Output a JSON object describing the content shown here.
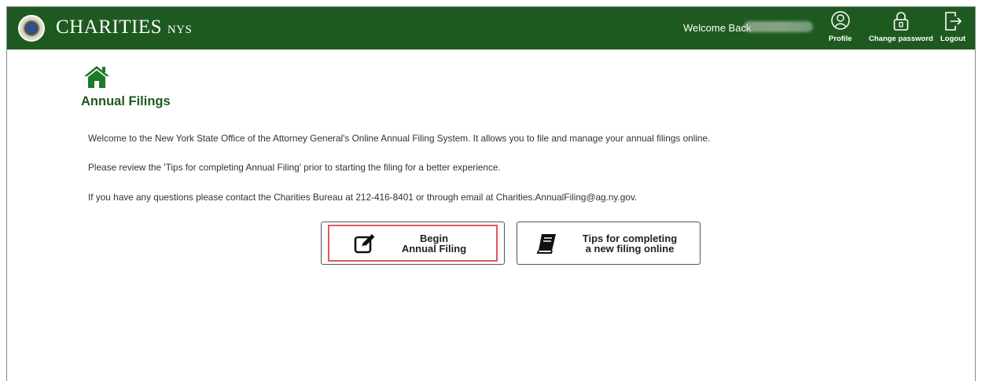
{
  "header": {
    "brand_main": "CHARITIES",
    "brand_small": "NYS",
    "welcome_text": "Welcome Back",
    "profile_label": "Profile",
    "change_password_label": "Change password",
    "logout_label": "Logout",
    "bg_color": "#1e5a20"
  },
  "main": {
    "title": "Annual Filings",
    "paragraphs": [
      "Welcome to the New York State Office of the Attorney General's Online Annual Filing System. It allows you to file and manage your annual filings online.",
      "Please review the 'Tips for completing Annual Filing' prior to starting the filing for a better experience.",
      "If you have any questions please contact the Charities Bureau at 212-416-8401 or through email at Charities.AnnualFiling@ag.ny.gov."
    ],
    "begin_button": {
      "line1": "Begin",
      "line2": "Annual Filing",
      "icon": "edit-icon"
    },
    "tips_button": {
      "line1": "Tips for completing",
      "line2": "a new filing online",
      "icon": "book-icon"
    },
    "highlight_color": "#e05a5a"
  }
}
